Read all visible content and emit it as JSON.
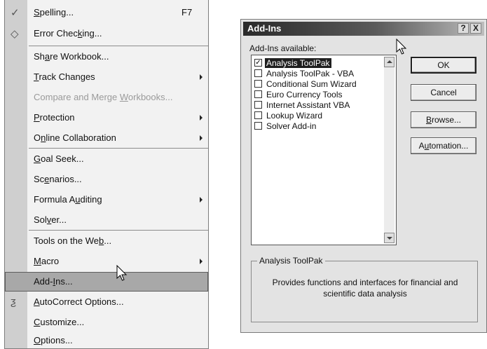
{
  "menu": {
    "items": [
      {
        "pre": "",
        "acc": "S",
        "post": "pelling...",
        "shortcut": "F7"
      },
      {
        "pre": "Error Chec",
        "acc": "k",
        "post": "ing..."
      },
      {
        "pre": "Sh",
        "acc": "a",
        "post": "re Workbook..."
      },
      {
        "pre": "",
        "acc": "T",
        "post": "rack Changes"
      },
      {
        "pre": "Compare and Merge ",
        "acc": "W",
        "post": "orkbooks..."
      },
      {
        "pre": "",
        "acc": "P",
        "post": "rotection"
      },
      {
        "pre": "O",
        "acc": "n",
        "post": "line Collaboration"
      },
      {
        "pre": "",
        "acc": "G",
        "post": "oal Seek..."
      },
      {
        "pre": "Sc",
        "acc": "e",
        "post": "narios..."
      },
      {
        "pre": "Formula A",
        "acc": "u",
        "post": "diting"
      },
      {
        "pre": "Sol",
        "acc": "v",
        "post": "er..."
      },
      {
        "pre": "Tools on the We",
        "acc": "b",
        "post": "..."
      },
      {
        "pre": "",
        "acc": "M",
        "post": "acro"
      },
      {
        "pre": "Add-",
        "acc": "I",
        "post": "ns..."
      },
      {
        "pre": "",
        "acc": "A",
        "post": "utoCorrect Options..."
      },
      {
        "pre": "",
        "acc": "C",
        "post": "ustomize..."
      },
      {
        "pre": "",
        "acc": "O",
        "post": "ptions..."
      }
    ]
  },
  "dialog": {
    "title": "Add-Ins",
    "help_btn": "?",
    "close_btn": "X",
    "available_label": "Add-Ins available:",
    "addins": [
      {
        "name": "Analysis ToolPak",
        "checked": true,
        "selected": true
      },
      {
        "name": "Analysis ToolPak - VBA",
        "checked": false
      },
      {
        "name": "Conditional Sum Wizard",
        "checked": false
      },
      {
        "name": "Euro Currency Tools",
        "checked": false
      },
      {
        "name": "Internet Assistant VBA",
        "checked": false
      },
      {
        "name": "Lookup Wizard",
        "checked": false
      },
      {
        "name": "Solver Add-in",
        "checked": false
      }
    ],
    "buttons": {
      "ok": {
        "pre": "",
        "acc": "",
        "post": "OK"
      },
      "cancel": {
        "pre": "",
        "acc": "",
        "post": "Cancel"
      },
      "browse": {
        "pre": "",
        "acc": "B",
        "post": "rowse..."
      },
      "automation": {
        "pre": "A",
        "acc": "u",
        "post": "tomation..."
      }
    },
    "group_title": "Analysis ToolPak",
    "description": "Provides functions and interfaces for financial and scientific data analysis"
  }
}
